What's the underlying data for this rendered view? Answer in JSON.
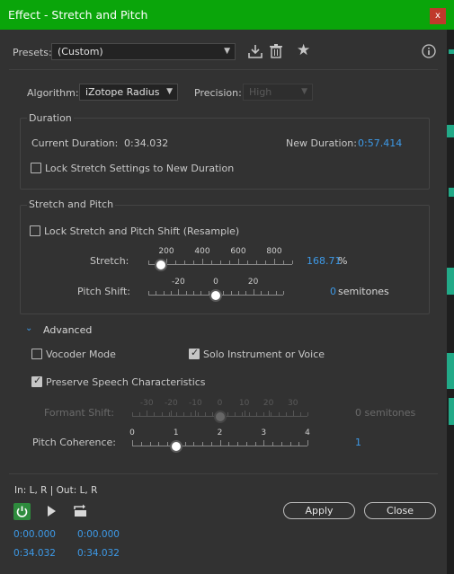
{
  "window": {
    "title": "Effect - Stretch and Pitch",
    "close_glyph": "x"
  },
  "presets": {
    "label": "Presets:",
    "value": "(Custom)"
  },
  "algorithm": {
    "label": "Algorithm:",
    "value": "iZotope Radius",
    "precision_label": "Precision:",
    "precision_value": "High"
  },
  "duration": {
    "section_title": "Duration",
    "current_label": "Current Duration:",
    "current_value": "0:34.032",
    "new_label": "New Duration:",
    "new_value": "0:57.414",
    "lock_label": "Lock Stretch Settings to New Duration",
    "lock_checked": false
  },
  "stretch_pitch": {
    "section_title": "Stretch and Pitch",
    "lock_label": "Lock Stretch and Pitch Shift (Resample)",
    "lock_checked": false,
    "stretch": {
      "label": "Stretch:",
      "tick_labels": [
        "200",
        "400",
        "600",
        "800"
      ],
      "value": "168.71",
      "unit": "%",
      "min": 100,
      "max": 900,
      "current": 168.71
    },
    "pitch": {
      "label": "Pitch Shift:",
      "tick_labels": [
        "-20",
        "0",
        "20"
      ],
      "value": "0",
      "unit": "semitones",
      "min": -36,
      "max": 36,
      "current": 0
    }
  },
  "advanced": {
    "title": "Advanced",
    "vocoder_label": "Vocoder Mode",
    "vocoder_checked": false,
    "solo_label": "Solo Instrument or Voice",
    "solo_checked": true,
    "preserve_label": "Preserve Speech Characteristics",
    "preserve_checked": true,
    "formant": {
      "label": "Formant Shift:",
      "tick_labels": [
        "-30",
        "-20",
        "-10",
        "0",
        "10",
        "20",
        "30"
      ],
      "value": "0 semitones",
      "min": -36,
      "max": 36,
      "current": 0
    },
    "coherence": {
      "label": "Pitch Coherence:",
      "tick_labels": [
        "0",
        "1",
        "2",
        "3",
        "4"
      ],
      "value": "1",
      "min": 0,
      "max": 4,
      "current": 1
    }
  },
  "footer": {
    "io_label": "In: L, R | Out: L, R",
    "apply_label": "Apply",
    "close_label": "Close",
    "times": {
      "r1c1": "0:00.000",
      "r1c2": "0:00.000",
      "r2c1": "0:34.032",
      "r2c2": "0:34.032"
    }
  },
  "colors": {
    "titlebar": "#0aa50a",
    "accent": "#3d9ae8",
    "close": "#c0392b",
    "power": "#2e8b3d"
  }
}
